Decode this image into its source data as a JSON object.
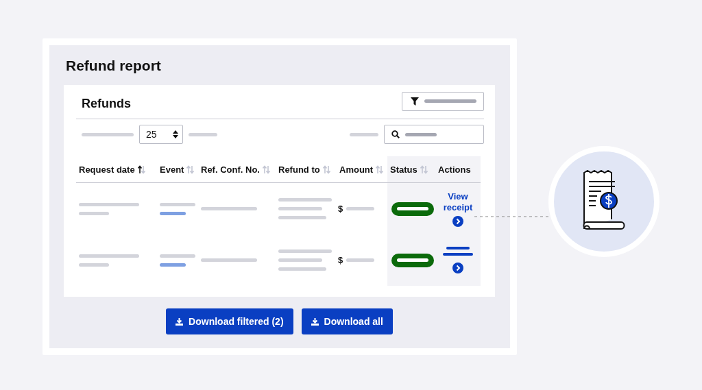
{
  "page_title": "Refund report",
  "card": {
    "title": "Refunds",
    "page_size": {
      "value": "25"
    }
  },
  "table": {
    "columns": [
      {
        "label": "Request date",
        "sortable": true,
        "sorted_ascending": true
      },
      {
        "label": "Event",
        "sortable": true,
        "sorted_ascending": false
      },
      {
        "label": "Ref. Conf. No.",
        "sortable": true,
        "sorted_ascending": false
      },
      {
        "label": "Refund to",
        "sortable": true,
        "sorted_ascending": false
      },
      {
        "label": "Amount",
        "sortable": true,
        "sorted_ascending": false
      },
      {
        "label": "Status",
        "sortable": true,
        "sorted_ascending": false
      },
      {
        "label": "Actions",
        "sortable": false
      }
    ],
    "rows": [
      {
        "currency": "$",
        "action": {
          "kind": "link",
          "label": "View receipt"
        }
      },
      {
        "currency": "$",
        "action": {
          "kind": "placeholder"
        }
      }
    ]
  },
  "buttons": [
    {
      "label": "Download filtered (2)"
    },
    {
      "label": "Download all"
    }
  ]
}
